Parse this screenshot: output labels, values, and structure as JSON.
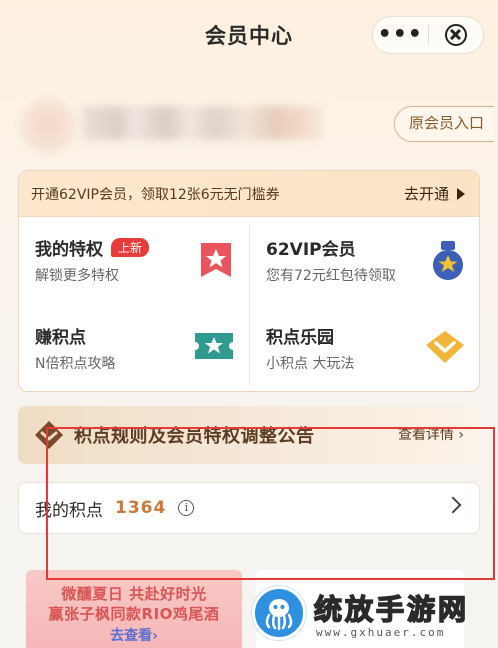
{
  "header": {
    "title": "会员中心",
    "more_label": "•••"
  },
  "user": {
    "old_entry_label": "原会员入口"
  },
  "promo": {
    "text": "开通62VIP会员，领取12张6元无门槛券",
    "cta": "去开通"
  },
  "features": [
    {
      "title": "我的特权",
      "badge": "上新",
      "subtitle": "解锁更多特权",
      "icon": "ribbon-star-icon",
      "color": "#e8555c"
    },
    {
      "title": "62VIP会员",
      "subtitle": "您有72元红包待领取",
      "icon": "vip-medal-icon",
      "color": "#3d5fb8"
    },
    {
      "title": "赚积点",
      "subtitle": "N倍积点攻略",
      "icon": "ticket-star-icon",
      "color": "#2f9a8f"
    },
    {
      "title": "积点乐园",
      "subtitle": "小积点 大玩法",
      "icon": "diamond-icon",
      "color": "#f0b43a"
    }
  ],
  "notice": {
    "title": "积点规则及会员特权调整公告",
    "more": "查看详情 ›"
  },
  "points": {
    "label": "我的积点",
    "value": "1364",
    "info_glyph": "i"
  },
  "banner": {
    "line1": "微醺夏日 共赴好时光",
    "line2": "赢张子枫同款RIO鸡尾酒",
    "line3": "去查看›"
  },
  "watermark": {
    "title": "统放手游网",
    "url": "www.gxhuaer.com"
  },
  "colors": {
    "accent": "#e63c3c",
    "points": "#c8793c",
    "highlight": "#e53935"
  }
}
